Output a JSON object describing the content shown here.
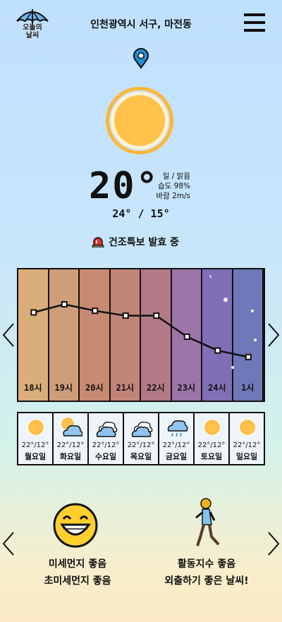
{
  "header": {
    "logo_text_line1": "오늘의",
    "logo_text_line2": "날씨",
    "location": "인천광역시 서구, 마전동",
    "menu_icon": "hamburger-menu-icon",
    "pin_icon": "location-pin-icon"
  },
  "current": {
    "icon": "sun-icon",
    "temperature": "20°",
    "condition": "일 / 맑음",
    "humidity": "습도 98%",
    "wind": "바람 2m/s",
    "high_low": "24° / 15°",
    "alert_icon": "siren-icon",
    "alert_text": "건조특보 발효 중"
  },
  "hourly": {
    "items": [
      {
        "time": "18시",
        "temp": 20
      },
      {
        "time": "19시",
        "temp": 21
      },
      {
        "time": "20시",
        "temp": 20.2
      },
      {
        "time": "21시",
        "temp": 19.6
      },
      {
        "time": "22시",
        "temp": 19.6
      },
      {
        "time": "23시",
        "temp": 17
      },
      {
        "time": "24시",
        "temp": 15.3
      },
      {
        "time": "1시",
        "temp": 14.5
      }
    ],
    "colors": [
      "#d9ae7a",
      "#cf9e78",
      "#c88a72",
      "#c18578",
      "#b27a86",
      "#9c75a8",
      "#7f70b6",
      "#6f78b8"
    ],
    "line_color": "#111111"
  },
  "weekly": {
    "days": [
      {
        "icon": "sun-icon",
        "temps": "22°/12°",
        "day": "월요일"
      },
      {
        "icon": "sun-cloud-icon",
        "temps": "22°/12°",
        "day": "화요일"
      },
      {
        "icon": "cloud-icon",
        "temps": "22°/12°",
        "day": "수요일"
      },
      {
        "icon": "cloud-icon",
        "temps": "22°/12°",
        "day": "목요일"
      },
      {
        "icon": "rain-cloud-icon",
        "temps": "22°/12°",
        "day": "금요일"
      },
      {
        "icon": "sun-icon",
        "temps": "22°/12°",
        "day": "토요일"
      },
      {
        "icon": "sun-icon",
        "temps": "22°/12°",
        "day": "일요일"
      }
    ]
  },
  "bottom": {
    "left_line1": "미세먼지 좋음",
    "left_line2": "초미세먼지 좋음",
    "right_line1": "활동지수 좋음",
    "right_line2": "외출하기 좋은 날씨!",
    "left_icon": "smiley-face-icon",
    "right_icon": "walking-person-icon"
  },
  "colors": {
    "sun": "#ffc24a",
    "sun_ring": "#ffb637",
    "accent_blue": "#1f8fd8"
  }
}
